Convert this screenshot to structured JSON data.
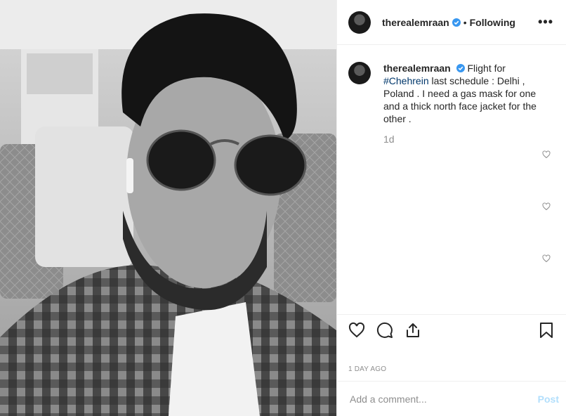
{
  "post": {
    "username": "therealemraan",
    "follow_status": "Following",
    "separator": "•",
    "more_label": "•••"
  },
  "caption": {
    "username": "therealemraan",
    "text_before": "Flight for ",
    "hashtag": "#Chehrein",
    "text_after": " last schedule : Delhi , Poland . I need a gas mask for one and a thick north face jacket for the other .",
    "age": "1d"
  },
  "footer": {
    "time_ago": "1 DAY AGO",
    "comment_placeholder": "Add a comment...",
    "post_label": "Post"
  },
  "colors": {
    "link": "#00376b",
    "verified": "#3897f0",
    "post_disabled": "#b2dffc"
  },
  "icons": [
    "verified-icon",
    "more-icon",
    "like-icon",
    "comment-icon",
    "share-icon",
    "save-icon",
    "heart-small-icon"
  ]
}
